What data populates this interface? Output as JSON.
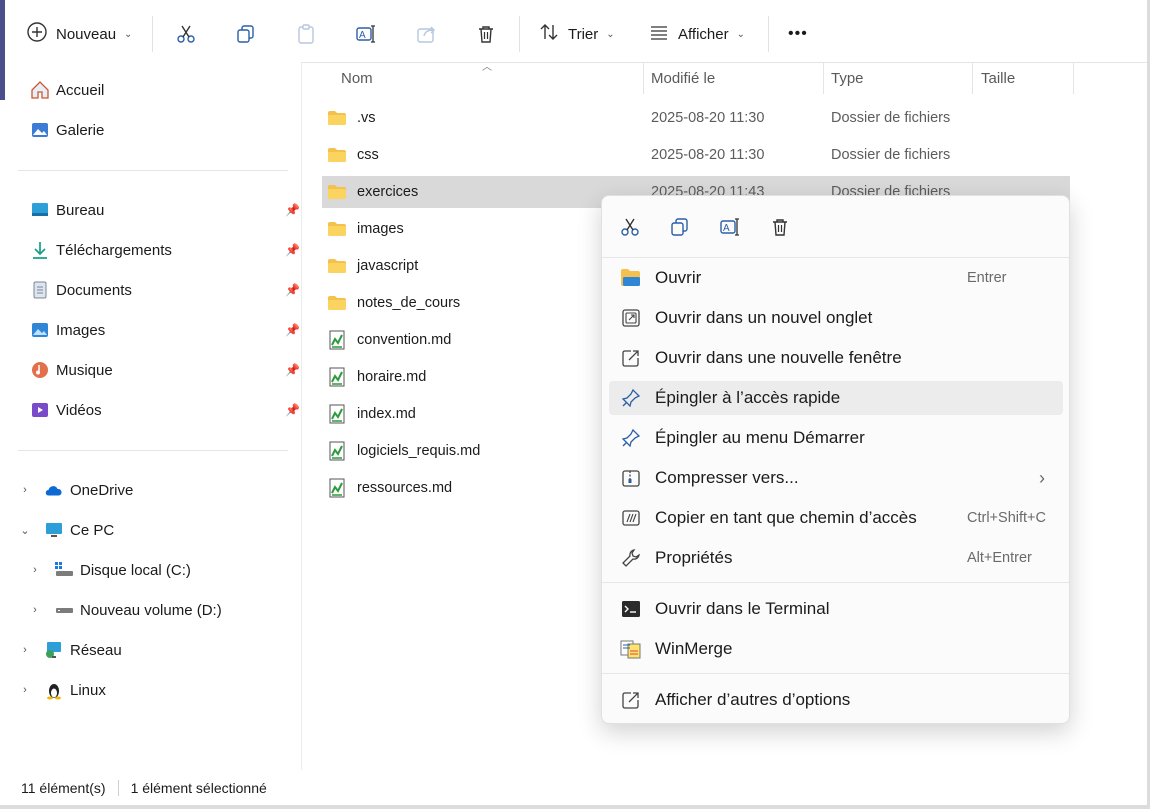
{
  "toolbar": {
    "new_label": "Nouveau",
    "sort_label": "Trier",
    "view_label": "Afficher",
    "more_label": "•••"
  },
  "sidebar": {
    "quick": [
      {
        "label": "Accueil",
        "icon": "home-icon"
      },
      {
        "label": "Galerie",
        "icon": "gallery-icon"
      }
    ],
    "pinned": [
      {
        "label": "Bureau",
        "icon": "desktop-icon"
      },
      {
        "label": "Téléchargements",
        "icon": "download-icon"
      },
      {
        "label": "Documents",
        "icon": "documents-icon"
      },
      {
        "label": "Images",
        "icon": "images-icon"
      },
      {
        "label": "Musique",
        "icon": "music-icon"
      },
      {
        "label": "Vidéos",
        "icon": "videos-icon"
      }
    ],
    "tree": [
      {
        "label": "OneDrive",
        "icon": "cloud-icon",
        "expander": "›"
      },
      {
        "label": "Ce PC",
        "icon": "pc-icon",
        "expander": "⌄"
      },
      {
        "label": "Disque local (C:)",
        "icon": "drive-icon",
        "expander": "›"
      },
      {
        "label": "Nouveau volume (D:)",
        "icon": "drive-icon",
        "expander": "›"
      },
      {
        "label": "Réseau",
        "icon": "network-icon",
        "expander": "›"
      },
      {
        "label": "Linux",
        "icon": "linux-icon",
        "expander": "›"
      }
    ]
  },
  "columns": {
    "name": "Nom",
    "modified": "Modifié le",
    "type": "Type",
    "size": "Taille"
  },
  "files": [
    {
      "name": ".vs",
      "date": "2025-08-20 11:30",
      "type": "Dossier de fichiers",
      "kind": "folder"
    },
    {
      "name": "css",
      "date": "2025-08-20 11:30",
      "type": "Dossier de fichiers",
      "kind": "folder"
    },
    {
      "name": "exercices",
      "date": "2025-08-20 11:43",
      "type": "Dossier de fichiers",
      "kind": "folder"
    },
    {
      "name": "images",
      "date": "",
      "type": "",
      "kind": "folder"
    },
    {
      "name": "javascript",
      "date": "",
      "type": "",
      "kind": "folder"
    },
    {
      "name": "notes_de_cours",
      "date": "",
      "type": "",
      "kind": "folder"
    },
    {
      "name": "convention.md",
      "date": "",
      "type": "",
      "kind": "md"
    },
    {
      "name": "horaire.md",
      "date": "",
      "type": "",
      "kind": "md"
    },
    {
      "name": "index.md",
      "date": "",
      "type": "",
      "kind": "md"
    },
    {
      "name": "logiciels_requis.md",
      "date": "",
      "type": "",
      "kind": "md"
    },
    {
      "name": "ressources.md",
      "date": "",
      "type": "",
      "kind": "md"
    }
  ],
  "status": {
    "count": "11 élément(s)",
    "selected": "1 élément sélectionné"
  },
  "context_menu": {
    "items": [
      {
        "label": "Ouvrir",
        "shortcut": "Entrer",
        "icon": "folder-open-icon"
      },
      {
        "label": "Ouvrir dans un nouvel onglet",
        "shortcut": "",
        "icon": "new-tab-icon"
      },
      {
        "label": "Ouvrir dans une nouvelle fenêtre",
        "shortcut": "",
        "icon": "new-window-icon"
      },
      {
        "label": "Épingler à l’accès rapide",
        "shortcut": "",
        "icon": "pin-icon"
      },
      {
        "label": "Épingler au menu Démarrer",
        "shortcut": "",
        "icon": "pin-start-icon"
      },
      {
        "label": "Compresser vers...",
        "shortcut": "›",
        "icon": "zip-icon"
      },
      {
        "label": "Copier en tant que chemin d’accès",
        "shortcut": "Ctrl+Shift+C",
        "icon": "copy-path-icon"
      },
      {
        "label": "Propriétés",
        "shortcut": "Alt+Entrer",
        "icon": "wrench-icon"
      },
      {
        "label": "Ouvrir dans le Terminal",
        "shortcut": "",
        "icon": "terminal-icon"
      },
      {
        "label": "WinMerge",
        "shortcut": "",
        "icon": "winmerge-icon"
      },
      {
        "label": "Afficher d’autres d’options",
        "shortcut": "",
        "icon": "more-options-icon"
      }
    ]
  }
}
